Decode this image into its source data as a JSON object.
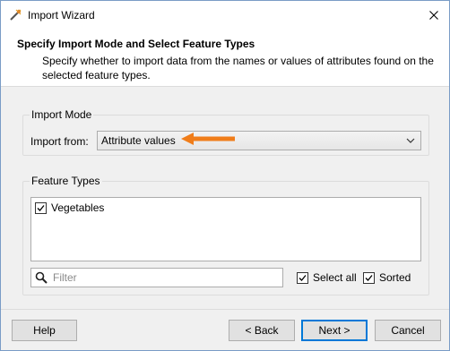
{
  "window": {
    "title": "Import Wizard"
  },
  "header": {
    "title": "Specify Import Mode and Select Feature Types",
    "description": "Specify whether to import data from the names or values of attributes found on the selected feature types."
  },
  "import_mode": {
    "group_label": "Import Mode",
    "import_from_label": "Import from:",
    "selected_value": "Attribute values"
  },
  "feature_types": {
    "group_label": "Feature Types",
    "items": [
      {
        "label": "Vegetables",
        "checked": true
      }
    ],
    "filter_placeholder": "Filter",
    "select_all_label": "Select all",
    "select_all_checked": true,
    "sorted_label": "Sorted",
    "sorted_checked": true
  },
  "buttons": {
    "help": "Help",
    "back": "< Back",
    "next": "Next >",
    "cancel": "Cancel"
  },
  "colors": {
    "arrow": "#f07d1a",
    "focus": "#0078d7"
  },
  "icons": [
    "wizard-app-icon",
    "close-icon",
    "chevron-down-icon",
    "arrow-icon",
    "search-icon",
    "checkmark-icon"
  ]
}
